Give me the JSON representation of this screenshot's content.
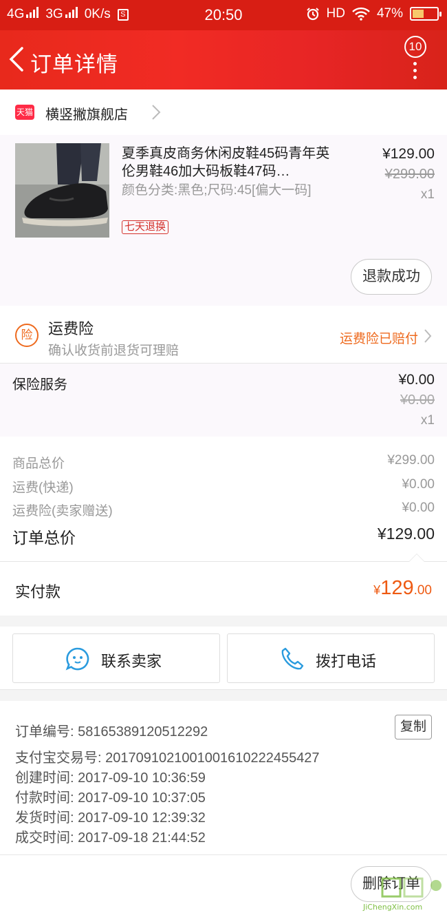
{
  "status_bar": {
    "network1": "4G",
    "network2": "3G",
    "speed": "0K/s",
    "s_icon": "S",
    "time": "20:50",
    "hd": "HD",
    "battery": "47%",
    "battery_level": 0.47
  },
  "nav": {
    "title": "订单详情",
    "badge": "10"
  },
  "shop": {
    "badge": "天猫",
    "name": "横竖撇旗舰店"
  },
  "product": {
    "title": "夏季真皮商务休闲皮鞋45码青年英伦男鞋46加大码板鞋47码…",
    "sku": "颜色分类:黑色;尺码:45[偏大一码]",
    "tag": "七天退换",
    "price": "¥129.00",
    "original_price": "¥299.00",
    "qty": "x1",
    "refund_status": "退款成功"
  },
  "shipping_insurance": {
    "icon": "险",
    "title": "运费险",
    "subtitle": "确认收货前退货可理赔",
    "status": "运费险已赔付"
  },
  "insurance_service": {
    "label": "保险服务",
    "price": "¥0.00",
    "original_price": "¥0.00",
    "qty": "x1"
  },
  "summary": {
    "items_label": "商品总价",
    "items_value": "¥299.00",
    "shipping_label": "运费(快递)",
    "shipping_value": "¥0.00",
    "ins_label": "运费险(卖家赠送)",
    "ins_value": "¥0.00",
    "total_label": "订单总价",
    "total_value": "¥129.00"
  },
  "paid": {
    "label": "实付款",
    "currency": "¥",
    "integer": "129",
    "decimal": ".00"
  },
  "actions": {
    "contact_seller": "联系卖家",
    "call": "拨打电话"
  },
  "order_info": {
    "order_no": "订单编号: 58165389120512292",
    "copy": "复制",
    "alipay_no": "支付宝交易号: 2017091021001001610222455427",
    "created": "创建时间: 2017-09-10 10:36:59",
    "paid": "付款时间: 2017-09-10 10:37:05",
    "shipped": "发货时间: 2017-09-10 12:39:32",
    "completed": "成交时间: 2017-09-18 21:44:52"
  },
  "footer": {
    "delete_order": "删除订单"
  },
  "watermark": {
    "text": "JiChengXin.com"
  },
  "colors": {
    "header_red": "#e8291c",
    "accent_orange": "#ee6a1e",
    "paid_orange": "#ee5a12",
    "tag_red": "#d4312b",
    "icon_blue": "#2a9bde"
  }
}
